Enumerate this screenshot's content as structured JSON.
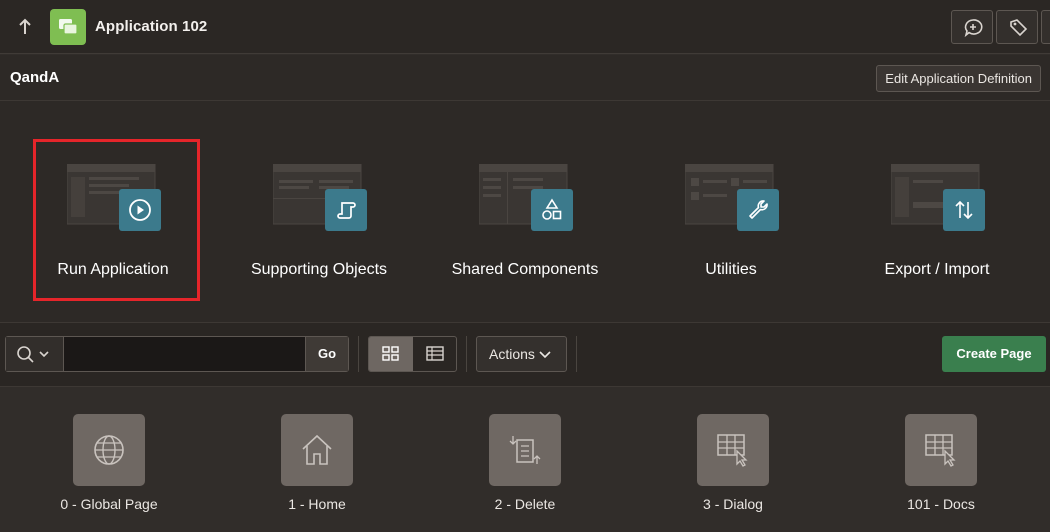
{
  "topbar": {
    "app_title": "Application 102",
    "app_icon_color": "#7fbe52",
    "icons": [
      "up-arrow-icon",
      "app-icon",
      "feedback-icon",
      "tag-icon"
    ]
  },
  "subhead": {
    "app_name": "QandA",
    "edit_definition_label": "Edit Application Definition"
  },
  "tiles": [
    {
      "label": "Run Application",
      "icon": "play-icon",
      "highlighted": true
    },
    {
      "label": "Supporting Objects",
      "icon": "scroll-icon"
    },
    {
      "label": "Shared Components",
      "icon": "shapes-icon"
    },
    {
      "label": "Utilities",
      "icon": "wrench-icon"
    },
    {
      "label": "Export / Import",
      "icon": "arrows-updown-icon"
    }
  ],
  "toolbar": {
    "search_value": "",
    "search_placeholder": "",
    "go_label": "Go",
    "actions_label": "Actions",
    "create_page_label": "Create Page",
    "view_mode": "icons"
  },
  "pages": [
    {
      "label": "0 - Global Page",
      "icon": "globe-icon"
    },
    {
      "label": "1 - Home",
      "icon": "home-icon"
    },
    {
      "label": "2 - Delete",
      "icon": "delete-page-icon"
    },
    {
      "label": "3 - Dialog",
      "icon": "grid-cursor-icon"
    },
    {
      "label": "101 - Docs",
      "icon": "grid-cursor-icon"
    }
  ],
  "colors": {
    "badge": "#3c7a8c",
    "highlight_border": "#e5252a",
    "create_button": "#3a7f4e"
  }
}
